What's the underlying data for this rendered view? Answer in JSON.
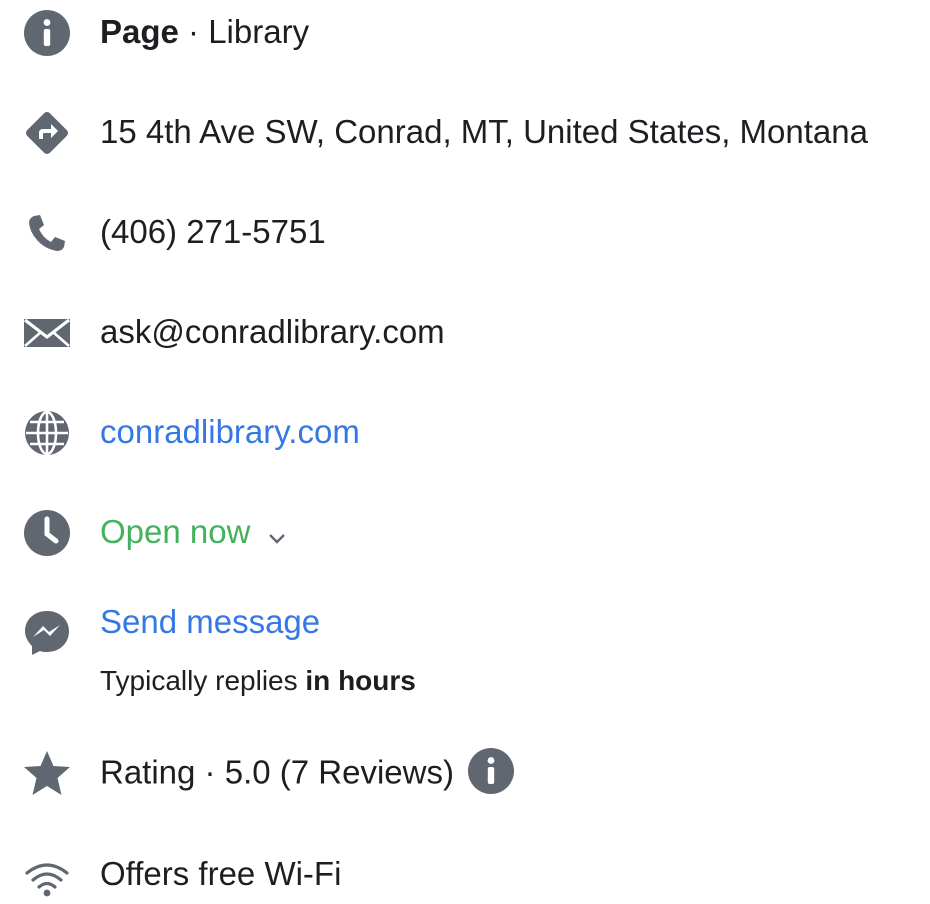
{
  "page_type": {
    "label": "Page",
    "separator": " · ",
    "category": "Library"
  },
  "address": "15 4th Ave SW, Conrad, MT, United States, Montana",
  "phone": "(406) 271-5751",
  "email": "ask@conradlibrary.com",
  "website": "conradlibrary.com",
  "hours": {
    "status": "Open now"
  },
  "message": {
    "action": "Send message",
    "reply_prefix": "Typically replies ",
    "reply_time": "in hours"
  },
  "rating": {
    "text": "Rating · 5.0 (7 Reviews)"
  },
  "wifi": "Offers free Wi-Fi",
  "colors": {
    "icon": "#606770",
    "link": "#3578e5",
    "open": "#44b15c",
    "text": "#1c1e21"
  },
  "icons": [
    "info-icon",
    "directions-icon",
    "phone-icon",
    "mail-icon",
    "globe-icon",
    "clock-icon",
    "messenger-icon",
    "star-icon",
    "wifi-icon",
    "chevron-down-icon"
  ]
}
